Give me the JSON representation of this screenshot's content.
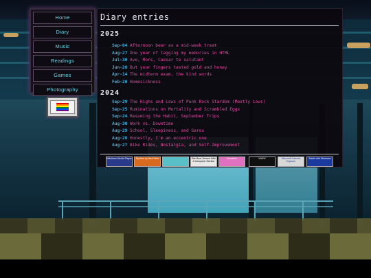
{
  "nav": {
    "items": [
      {
        "label": "Home",
        "name": "nav-home"
      },
      {
        "label": "Diary",
        "name": "nav-diary"
      },
      {
        "label": "Music",
        "name": "nav-music"
      },
      {
        "label": "Readings",
        "name": "nav-readings"
      },
      {
        "label": "Games",
        "name": "nav-games"
      },
      {
        "label": "Photography",
        "name": "nav-photography"
      }
    ]
  },
  "badge": {
    "icon": "pride-flag-icon"
  },
  "main": {
    "title": "Diary entries",
    "years": [
      {
        "year": "2025",
        "entries": [
          {
            "date": "Sep-04",
            "title": "Afternoon beer as a mid-week treat"
          },
          {
            "date": "Aug-27",
            "title": "One year of tagging my memories in HTML"
          },
          {
            "date": "Jul-30",
            "title": "Ave, Mors, Caesar te salutant"
          },
          {
            "date": "Jun-28",
            "title": "But your fingers tasted gold and honey"
          },
          {
            "date": "Apr-14",
            "title": "The midterm exam, the kind words"
          },
          {
            "date": "Feb-20",
            "title": "Homesickness"
          }
        ]
      },
      {
        "year": "2024",
        "entries": [
          {
            "date": "Sep-29",
            "title": "The Highs and Lows of Punk Rock Stardom (Mostly Lows)"
          },
          {
            "date": "Sep-25",
            "title": "Ruminations on Mortality and Scrambled Eggs"
          },
          {
            "date": "Sep-24",
            "title": "Resuming the Habit, September Trips"
          },
          {
            "date": "Aug-30",
            "title": "Work vs. Downtime"
          },
          {
            "date": "Aug-29",
            "title": "School, Sleepiness, and Garou"
          },
          {
            "date": "Aug-28",
            "title": "Honestly, I'm an eccentric one"
          },
          {
            "date": "Aug-27",
            "title": "Bike Rides, Nostalgia, and Self-Improvement"
          }
        ]
      }
    ]
  },
  "web_buttons": [
    {
      "text": "Windows Media Player",
      "bg": "#2a3a8a",
      "fg": "#ffffff"
    },
    {
      "text": "Spirited by NeoCities",
      "bg": "#d86a20",
      "fg": "#ffffff"
    },
    {
      "text": "",
      "bg": "#5ac0c8",
      "fg": "#ffffff"
    },
    {
      "text": "Site Best Viewed With A Computer Monitor",
      "bg": "#e8e8e8",
      "fg": "#000000"
    },
    {
      "text": "Neocities",
      "bg": "#e070c0",
      "fg": "#ffffff"
    },
    {
      "text": "WWW",
      "bg": "#101010",
      "fg": "#ffffff"
    },
    {
      "text": "Microsoft Internet Explorer",
      "bg": "#d8d8d8",
      "fg": "#1a3a9a"
    },
    {
      "text": "Made with Windows",
      "bg": "#1a3aa0",
      "fg": "#ffffff"
    }
  ]
}
